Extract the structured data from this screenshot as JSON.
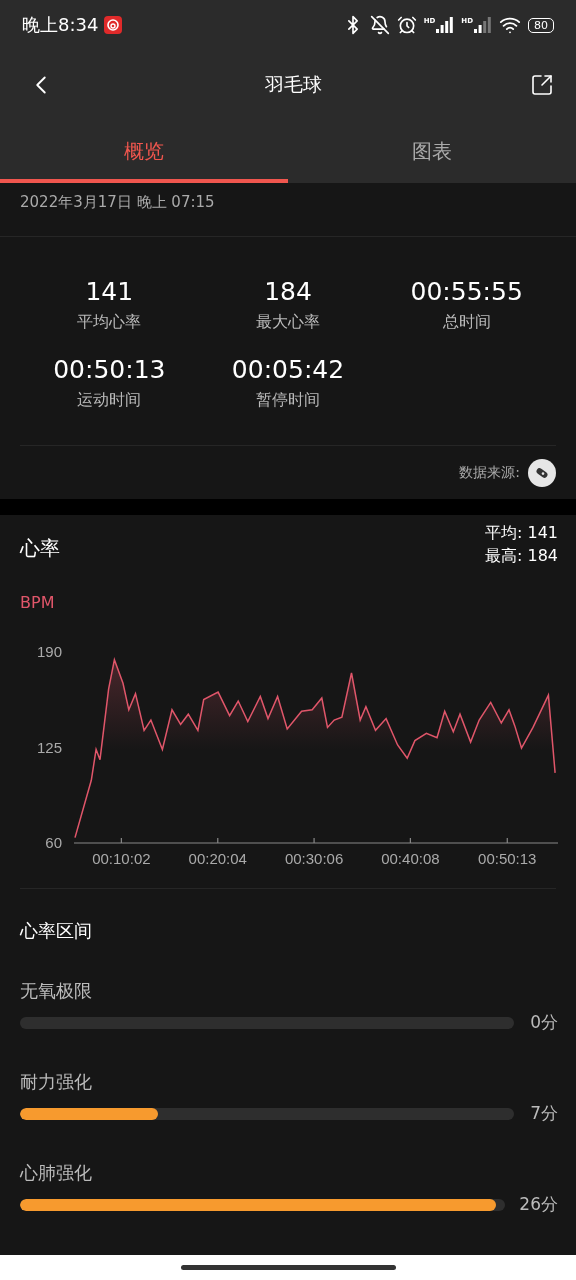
{
  "status_bar": {
    "time": "晚上8:34",
    "signal_labels": [
      "HD",
      "HD"
    ],
    "battery": "80"
  },
  "header": {
    "title": "羽毛球"
  },
  "tabs": [
    {
      "label": "概览",
      "selected": true
    },
    {
      "label": "图表",
      "selected": false
    }
  ],
  "date": "2022年3月17日 晚上 07:15",
  "stats": [
    {
      "value": "141",
      "label": "平均心率"
    },
    {
      "value": "184",
      "label": "最大心率"
    },
    {
      "value": "00:55:55",
      "label": "总时间"
    },
    {
      "value": "00:50:13",
      "label": "运动时间"
    },
    {
      "value": "00:05:42",
      "label": "暂停时间"
    }
  ],
  "data_source": "数据来源:",
  "heart_rate": {
    "title": "心率",
    "average": "平均: 141",
    "max": "最高: 184",
    "chart_data": {
      "type": "area",
      "ylabel": "BPM",
      "xlim": [
        5.2,
        55.4
      ],
      "ylim": [
        60,
        190
      ],
      "yticks": [
        60,
        125,
        190
      ],
      "xticks": [
        {
          "value": 10.03,
          "label": "00:10:02"
        },
        {
          "value": 20.07,
          "label": "00:20:04"
        },
        {
          "value": 30.1,
          "label": "00:30:06"
        },
        {
          "value": 40.13,
          "label": "00:40:08"
        },
        {
          "value": 50.22,
          "label": "00:50:13"
        }
      ],
      "x": [
        5.2,
        6.9,
        7.4,
        7.8,
        8.7,
        9.3,
        10.2,
        10.8,
        11.5,
        12.4,
        13.1,
        14.3,
        15.3,
        16.2,
        17.0,
        18.0,
        18.6,
        20.1,
        21.3,
        22.2,
        23.2,
        24.5,
        25.3,
        26.3,
        27.3,
        28.8,
        29.9,
        30.9,
        31.5,
        32.2,
        33.0,
        34.0,
        34.9,
        35.5,
        36.5,
        37.6,
        38.8,
        39.8,
        40.6,
        41.8,
        42.9,
        43.7,
        44.6,
        45.3,
        46.4,
        47.3,
        48.5,
        49.6,
        50.4,
        51.0,
        51.7,
        52.9,
        54.5,
        55.2
      ],
      "series": [
        {
          "color": "#e0566a",
          "values": [
            63,
            102,
            123,
            116,
            164,
            184,
            168,
            150,
            161,
            136,
            143,
            123,
            150,
            140,
            147,
            136,
            157,
            162,
            146,
            156,
            142,
            159,
            144,
            159,
            137,
            149,
            150,
            158,
            138,
            143,
            145,
            175,
            143,
            152,
            136,
            144,
            126,
            117,
            129,
            134,
            131,
            149,
            135,
            147,
            128,
            143,
            155,
            141,
            150,
            139,
            124,
            138,
            160,
            107
          ]
        }
      ]
    }
  },
  "zones": {
    "title": "心率区间",
    "items": [
      {
        "label": "无氧极限",
        "value": "0分",
        "level": 0
      },
      {
        "label": "耐力强化",
        "value": "7分",
        "level": 0.28
      },
      {
        "label": "心肺强化",
        "value": "26分",
        "level": 0.98
      }
    ]
  }
}
